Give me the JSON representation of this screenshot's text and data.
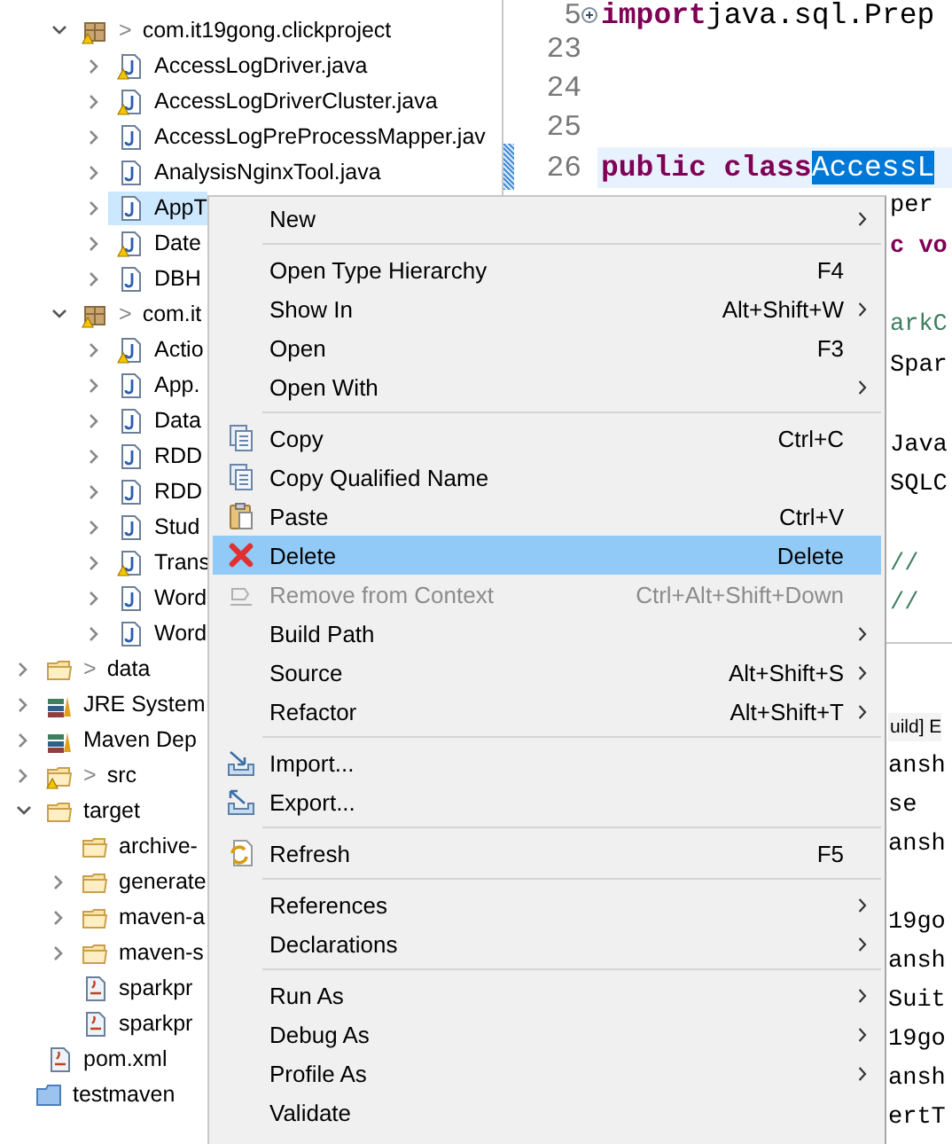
{
  "tree": {
    "roots": [
      {
        "kind": "container",
        "children": [
          {
            "kind": "container",
            "children": [
              {
                "kind": "package",
                "prefix": ">",
                "label": "com.it19gong.clickproject",
                "expanded": true,
                "selected": false,
                "children": [
                  {
                    "kind": "java_warn",
                    "label": "AccessLogDriver.java",
                    "expanded": false,
                    "selected": false
                  },
                  {
                    "kind": "java_warn",
                    "label": "AccessLogDriverCluster.java",
                    "expanded": false,
                    "selected": false
                  },
                  {
                    "kind": "java",
                    "label": "AccessLogPreProcessMapper.jav",
                    "expanded": false,
                    "selected": false
                  },
                  {
                    "kind": "java",
                    "label": "AnalysisNginxTool.java",
                    "expanded": false,
                    "selected": false
                  },
                  {
                    "kind": "java",
                    "label": "AppT",
                    "expanded": false,
                    "selected": true
                  },
                  {
                    "kind": "java_warn",
                    "label": "Date",
                    "expanded": false,
                    "selected": false
                  },
                  {
                    "kind": "java",
                    "label": "DBH",
                    "expanded": false,
                    "selected": false
                  }
                ]
              },
              {
                "kind": "package",
                "prefix": ">",
                "label": "com.it",
                "expanded": true,
                "selected": false,
                "children": [
                  {
                    "kind": "java_warn",
                    "label": "Actio",
                    "expanded": false,
                    "selected": false
                  },
                  {
                    "kind": "java",
                    "label": "App.",
                    "expanded": false,
                    "selected": false
                  },
                  {
                    "kind": "java",
                    "label": "Data",
                    "expanded": false,
                    "selected": false
                  },
                  {
                    "kind": "java",
                    "label": "RDD",
                    "expanded": false,
                    "selected": false
                  },
                  {
                    "kind": "java",
                    "label": "RDD",
                    "expanded": false,
                    "selected": false
                  },
                  {
                    "kind": "java",
                    "label": "Stud",
                    "expanded": false,
                    "selected": false
                  },
                  {
                    "kind": "java_warn",
                    "label": "Trans",
                    "expanded": false,
                    "selected": false
                  },
                  {
                    "kind": "java",
                    "label": "Word",
                    "expanded": false,
                    "selected": false
                  },
                  {
                    "kind": "java",
                    "label": "Word",
                    "expanded": false,
                    "selected": false
                  }
                ]
              }
            ]
          },
          {
            "kind": "data_folder",
            "prefix": ">",
            "label": "data",
            "expanded": false,
            "selected": false
          },
          {
            "kind": "library",
            "label": "JRE System",
            "expanded": false,
            "selected": false
          },
          {
            "kind": "library",
            "label": "Maven Dep",
            "expanded": false,
            "selected": false
          },
          {
            "kind": "src_folder",
            "prefix": ">",
            "label": "src",
            "expanded": false,
            "selected": false
          },
          {
            "kind": "folder",
            "label": "target",
            "expanded": true,
            "selected": false,
            "children": [
              {
                "kind": "folder",
                "label": "archive-",
                "selected": false
              },
              {
                "kind": "folder",
                "label": "generate",
                "expanded": false,
                "selected": false
              },
              {
                "kind": "folder",
                "label": "maven-a",
                "expanded": false,
                "selected": false
              },
              {
                "kind": "folder",
                "label": "maven-s",
                "expanded": false,
                "selected": false
              },
              {
                "kind": "jar",
                "label": "sparkpr",
                "selected": false
              },
              {
                "kind": "jar",
                "label": "sparkpr",
                "selected": false
              }
            ]
          },
          {
            "kind": "xml",
            "label": "pom.xml",
            "selected": false
          }
        ]
      },
      {
        "kind": "project",
        "label": "testmaven",
        "selected": false
      }
    ]
  },
  "editor": {
    "lines": [
      {
        "kind": "code",
        "number": "5",
        "folded": true,
        "tokens": [
          {
            "kind": "keyword",
            "text": "import"
          },
          {
            "kind": "plain",
            "text": " java.sql.Prep"
          }
        ]
      },
      {
        "kind": "blank",
        "number": "23"
      },
      {
        "kind": "blank",
        "number": "24"
      },
      {
        "kind": "blank",
        "number": "25"
      },
      {
        "kind": "code",
        "number": "26",
        "current": true,
        "tokens": [
          {
            "kind": "keyword",
            "text": "public class "
          },
          {
            "kind": "selection",
            "text": "AccessL"
          }
        ]
      },
      {
        "kind": "code",
        "tokens": [
          {
            "kind": "plain",
            "text": "per"
          }
        ]
      },
      {
        "kind": "code",
        "tokens": [
          {
            "kind": "keyword",
            "text": "c vo"
          }
        ]
      },
      {
        "kind": "blank"
      },
      {
        "kind": "code",
        "tokens": [
          {
            "kind": "comment",
            "text": "arkC"
          }
        ]
      },
      {
        "kind": "code",
        "tokens": [
          {
            "kind": "plain",
            "text": "Spar"
          }
        ]
      },
      {
        "kind": "blank"
      },
      {
        "kind": "code",
        "tokens": [
          {
            "kind": "plain",
            "text": "Java"
          }
        ]
      },
      {
        "kind": "code",
        "tokens": [
          {
            "kind": "plain",
            "text": "SQLC"
          }
        ]
      },
      {
        "kind": "blank"
      },
      {
        "kind": "code",
        "tokens": [
          {
            "kind": "comment",
            "text": "//"
          }
        ]
      },
      {
        "kind": "code",
        "tokens": [
          {
            "kind": "comment",
            "text": "//"
          }
        ]
      }
    ]
  },
  "console": {
    "tab": "uild] E",
    "lines": [
      {
        "kind": "text",
        "text": "ansh"
      },
      {
        "kind": "text",
        "text": "se"
      },
      {
        "kind": "text",
        "text": "ansh"
      },
      {
        "kind": "blank"
      },
      {
        "kind": "text",
        "text": "19go"
      },
      {
        "kind": "text",
        "text": "ansh"
      },
      {
        "kind": "text",
        "text": "Suit"
      },
      {
        "kind": "text",
        "text": "19go"
      },
      {
        "kind": "text",
        "text": "ansh"
      },
      {
        "kind": "text",
        "text": "ertT"
      }
    ]
  },
  "context_menu": {
    "items": [
      {
        "kind": "item",
        "label": "New",
        "submenu": true,
        "disabled": false,
        "selected": false
      },
      {
        "kind": "separator"
      },
      {
        "kind": "item",
        "label": "Open Type Hierarchy",
        "shortcut": "F4",
        "submenu": false,
        "disabled": false,
        "selected": false
      },
      {
        "kind": "item",
        "label": "Show In",
        "shortcut": "Alt+Shift+W",
        "submenu": true,
        "disabled": false,
        "selected": false
      },
      {
        "kind": "item",
        "label": "Open",
        "shortcut": "F3",
        "submenu": false,
        "disabled": false,
        "selected": false
      },
      {
        "kind": "item",
        "label": "Open With",
        "submenu": true,
        "disabled": false,
        "selected": false
      },
      {
        "kind": "separator"
      },
      {
        "kind": "item",
        "label": "Copy",
        "shortcut": "Ctrl+C",
        "submenu": false,
        "disabled": false,
        "selected": false
      },
      {
        "kind": "item",
        "label": "Copy Qualified Name",
        "submenu": false,
        "disabled": false,
        "selected": false
      },
      {
        "kind": "item",
        "label": "Paste",
        "shortcut": "Ctrl+V",
        "submenu": false,
        "disabled": false,
        "selected": false
      },
      {
        "kind": "item",
        "label": "Delete",
        "shortcut": "Delete",
        "submenu": false,
        "disabled": false,
        "selected": true
      },
      {
        "kind": "item",
        "label": "Remove from Context",
        "shortcut": "Ctrl+Alt+Shift+Down",
        "submenu": false,
        "disabled": true,
        "selected": false
      },
      {
        "kind": "item",
        "label": "Build Path",
        "submenu": true,
        "disabled": false,
        "selected": false
      },
      {
        "kind": "item",
        "label": "Source",
        "shortcut": "Alt+Shift+S",
        "submenu": true,
        "disabled": false,
        "selected": false
      },
      {
        "kind": "item",
        "label": "Refactor",
        "shortcut": "Alt+Shift+T",
        "submenu": true,
        "disabled": false,
        "selected": false
      },
      {
        "kind": "separator"
      },
      {
        "kind": "item",
        "label": "Import...",
        "submenu": false,
        "disabled": false,
        "selected": false
      },
      {
        "kind": "item",
        "label": "Export...",
        "submenu": false,
        "disabled": false,
        "selected": false
      },
      {
        "kind": "separator"
      },
      {
        "kind": "item",
        "label": "Refresh",
        "shortcut": "F5",
        "submenu": false,
        "disabled": false,
        "selected": false
      },
      {
        "kind": "separator"
      },
      {
        "kind": "item",
        "label": "References",
        "submenu": true,
        "disabled": false,
        "selected": false
      },
      {
        "kind": "item",
        "label": "Declarations",
        "submenu": true,
        "disabled": false,
        "selected": false
      },
      {
        "kind": "separator"
      },
      {
        "kind": "item",
        "label": "Run As",
        "submenu": true,
        "disabled": false,
        "selected": false
      },
      {
        "kind": "item",
        "label": "Debug As",
        "submenu": true,
        "disabled": false,
        "selected": false
      },
      {
        "kind": "item",
        "label": "Profile As",
        "submenu": true,
        "disabled": false,
        "selected": false
      },
      {
        "kind": "item",
        "label": "Validate",
        "submenu": false,
        "disabled": false,
        "selected": false
      }
    ]
  }
}
